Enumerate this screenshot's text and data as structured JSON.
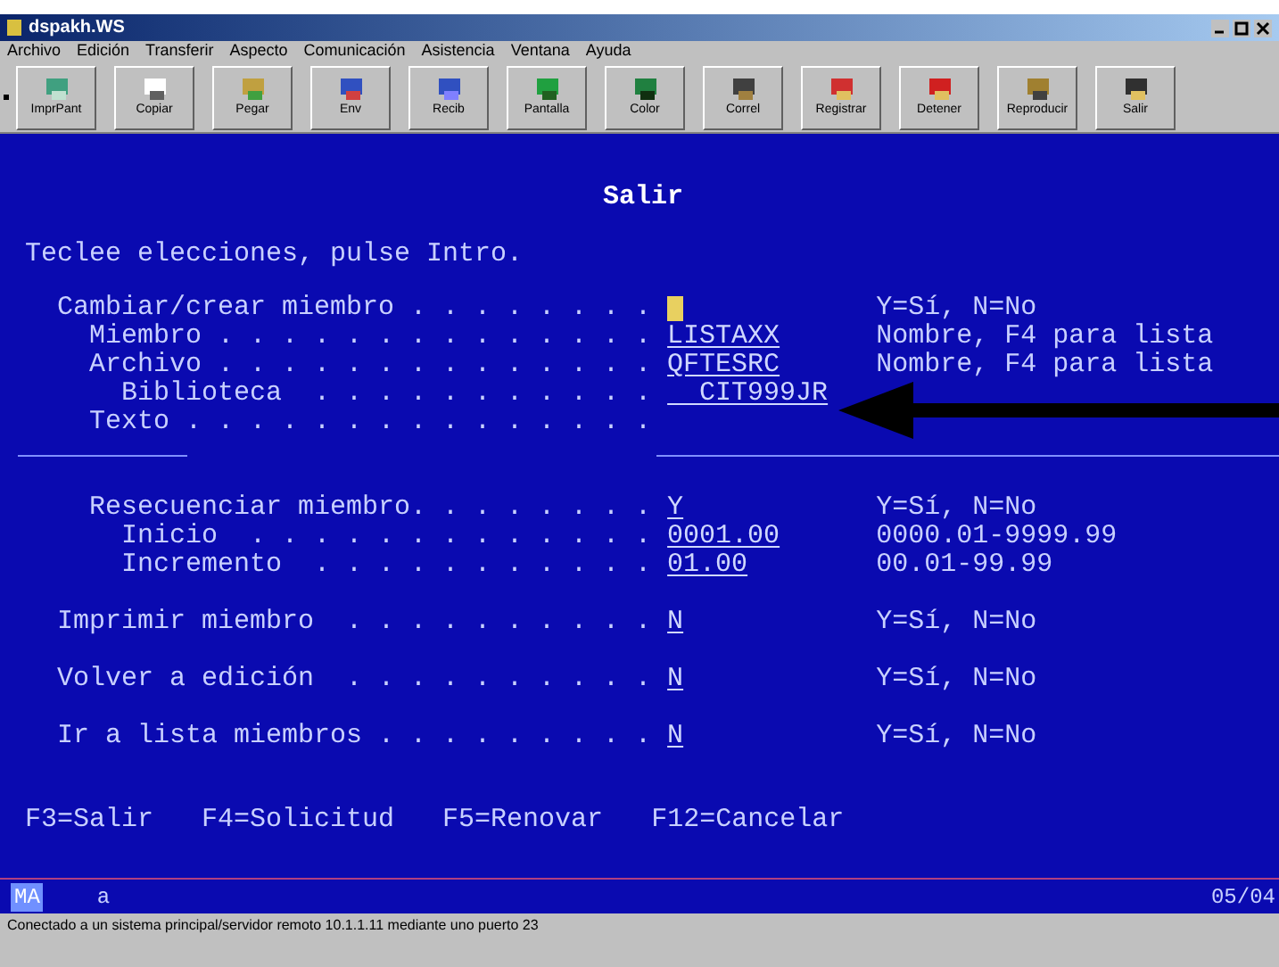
{
  "window": {
    "title": "dspakh.WS"
  },
  "menu": [
    "Archivo",
    "Edición",
    "Transferir",
    "Aspecto",
    "Comunicación",
    "Asistencia",
    "Ventana",
    "Ayuda"
  ],
  "toolbar": [
    "ImprPant",
    "Copiar",
    "Pegar",
    "Env",
    "Recib",
    "Pantalla",
    "Color",
    "Correl",
    "Registrar",
    "Detener",
    "Reproducir",
    "Salir"
  ],
  "terminal": {
    "title": "Salir",
    "instruction": "Teclee elecciones, pulse Intro.",
    "groups": [
      [
        {
          "label": "Cambiar/crear miembro . . . . . . . .",
          "field": {
            "kind": "cursor"
          },
          "hint": "Y=Sí, N=No"
        },
        {
          "label": "  Miembro . . . . . . . . . . . . . .",
          "field": {
            "kind": "input",
            "value": "LISTAXX"
          },
          "hint": "Nombre, F4 para lista"
        },
        {
          "label": "  Archivo . . . . . . . . . . . . . .",
          "field": {
            "kind": "input",
            "value": "QFTESRC"
          },
          "hint": "Nombre, F4 para lista"
        },
        {
          "label": "    Biblioteca  . . . . . . . . . . .",
          "field": {
            "kind": "input",
            "value": "  CIT999JR"
          }
        },
        {
          "label": "  Texto . . . . . . . . . . . . . . ."
        }
      ],
      [
        {
          "label": "  Resecuenciar miembro. . . . . . . .",
          "field": {
            "kind": "input",
            "value": "Y"
          },
          "hint": "Y=Sí, N=No"
        },
        {
          "label": "    Inicio  . . . . . . . . . . . . .",
          "field": {
            "kind": "input",
            "value": "0001.00"
          },
          "hint": "0000.01-9999.99"
        },
        {
          "label": "    Incremento  . . . . . . . . . . .",
          "field": {
            "kind": "input",
            "value": "01.00"
          },
          "hint": "00.01-99.99"
        }
      ],
      [
        {
          "label": "Imprimir miembro  . . . . . . . . . .",
          "field": {
            "kind": "input",
            "value": "N"
          },
          "hint": "Y=Sí, N=No"
        }
      ],
      [
        {
          "label": "Volver a edición  . . . . . . . . . .",
          "field": {
            "kind": "input",
            "value": "N"
          },
          "hint": "Y=Sí, N=No"
        }
      ],
      [
        {
          "label": "Ir a lista miembros . . . . . . . . .",
          "field": {
            "kind": "input",
            "value": "N"
          },
          "hint": "Y=Sí, N=No"
        }
      ]
    ],
    "function_keys": [
      "F3=Salir",
      "F4=Solicitud",
      "F5=Renovar",
      "F12=Cancelar"
    ],
    "oia": {
      "mode": "MA",
      "indicator": "a",
      "position": "05/04"
    }
  },
  "status_bar": "Conectado a un sistema principal/servidor remoto 10.1.1.11 mediante uno puerto 23"
}
